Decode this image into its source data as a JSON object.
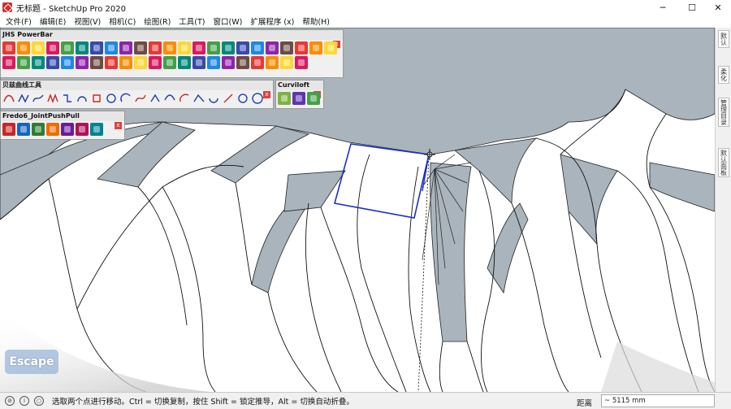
{
  "window": {
    "title": "无标题 - SketchUp Pro 2020",
    "min_glyph": "─",
    "max_glyph": "☐",
    "close_glyph": "✕"
  },
  "menu": [
    "文件(F)",
    "编辑(E)",
    "视图(V)",
    "相机(C)",
    "绘图(R)",
    "工具(T)",
    "窗口(W)",
    "扩展程序 (x)",
    "帮助(H)"
  ],
  "toolbars": {
    "jhs": {
      "title": "JHS PowerBar",
      "close": "x"
    },
    "bezier": {
      "title": "贝兹曲线工具",
      "close": "x"
    },
    "curviloft": {
      "title": "Curviloft",
      "close": "x"
    },
    "fredo": {
      "title": "Fredo6_JointPushPull",
      "close": "x"
    }
  },
  "tray_tabs": [
    "默认",
    "柔化",
    "管理目录",
    "默认面板"
  ],
  "overlay": {
    "escape_label": "Escape"
  },
  "status": {
    "message": "选取两个点进行移动。Ctrl = 切换复制，按住 Shift = 锁定推导，Alt = 切换自动折叠。",
    "measure_label": "距离",
    "measure_value": "~ 5115 mm"
  },
  "colors": {
    "face_gray": "#a9b4bc",
    "selection_blue": "#1a2fc4",
    "window_close": "#e04040"
  }
}
